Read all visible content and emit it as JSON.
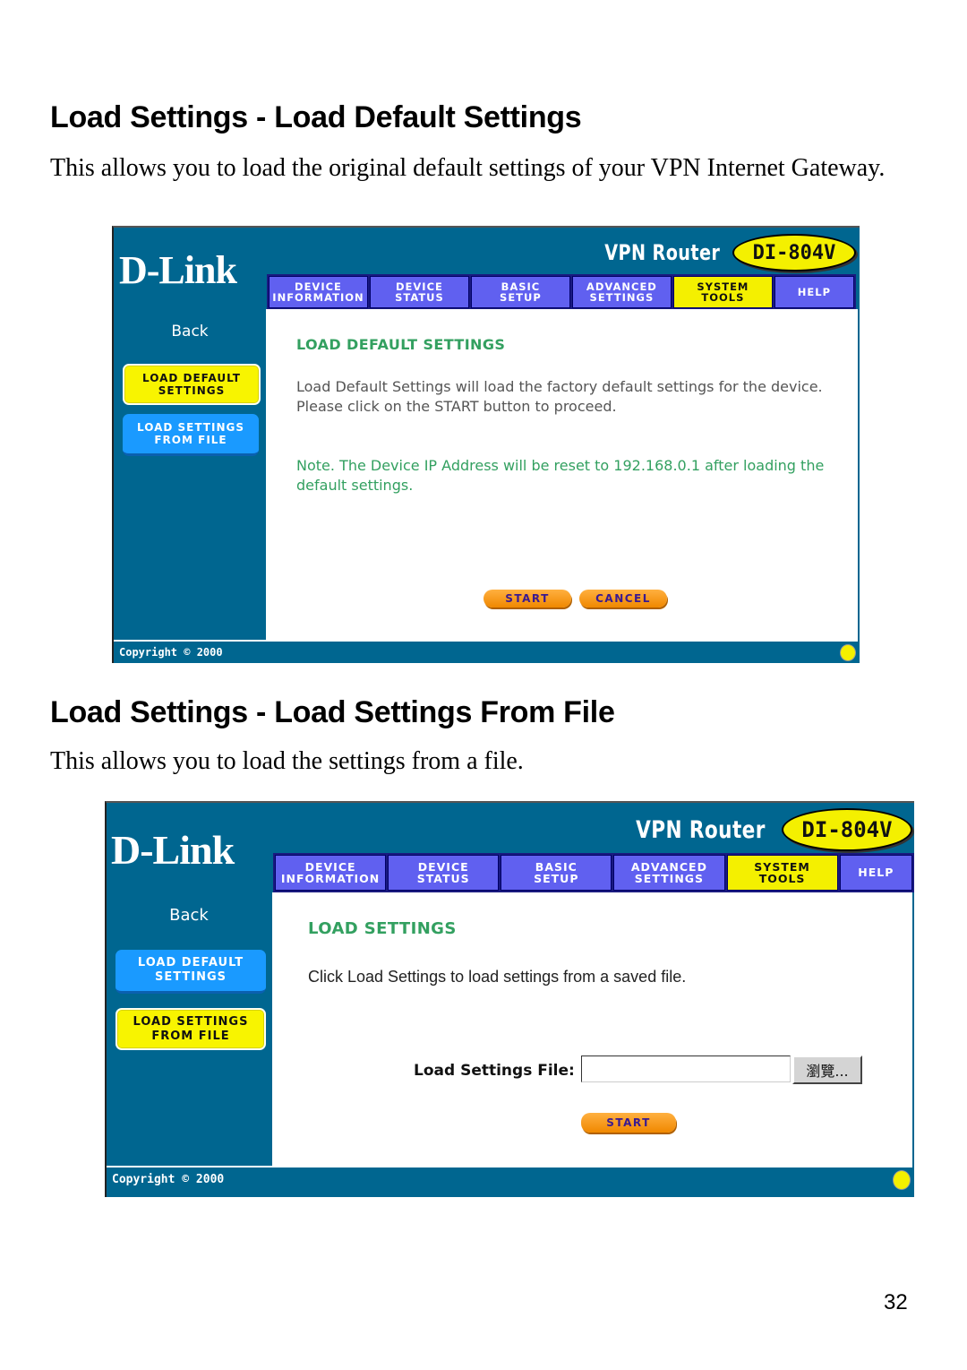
{
  "page": {
    "number": "32"
  },
  "section1": {
    "heading": "Load Settings - Load Default Settings",
    "description": "This allows you to load the original default settings of your VPN Internet Gateway.",
    "screenshot": {
      "logo": "D-Link",
      "product_title": "VPN Router",
      "model": "DI-804V",
      "nav_tabs": [
        {
          "line1": "DEVICE",
          "line2": "INFORMATION",
          "active": false
        },
        {
          "line1": "DEVICE",
          "line2": "STATUS",
          "active": false
        },
        {
          "line1": "BASIC",
          "line2": "SETUP",
          "active": false
        },
        {
          "line1": "ADVANCED",
          "line2": "SETTINGS",
          "active": false
        },
        {
          "line1": "SYSTEM",
          "line2": "TOOLS",
          "active": true
        },
        {
          "line1": "HELP",
          "line2": "",
          "active": false
        }
      ],
      "sidebar": {
        "back_label": "Back",
        "buttons": [
          {
            "line1": "LOAD DEFAULT",
            "line2": "SETTINGS",
            "state": "active"
          },
          {
            "line1": "LOAD SETTINGS",
            "line2": "FROM FILE",
            "state": "inactive"
          }
        ]
      },
      "content": {
        "title": "LOAD DEFAULT SETTINGS",
        "body": "Load Default Settings will load the factory default settings for the device. Please click on the START button to proceed.",
        "note": "Note. The Device IP Address will be reset to 192.168.0.1 after loading the default settings.",
        "start_label": "START",
        "cancel_label": "CANCEL"
      },
      "footer": {
        "copyright": "Copyright © 2000"
      }
    }
  },
  "section2": {
    "heading": "Load Settings - Load Settings From File",
    "description": "This allows you to load the settings from a file.",
    "screenshot": {
      "logo": "D-Link",
      "product_title": "VPN Router",
      "model": "DI-804V",
      "nav_tabs": [
        {
          "line1": "DEVICE",
          "line2": "INFORMATION",
          "active": false
        },
        {
          "line1": "DEVICE",
          "line2": "STATUS",
          "active": false
        },
        {
          "line1": "BASIC",
          "line2": "SETUP",
          "active": false
        },
        {
          "line1": "ADVANCED",
          "line2": "SETTINGS",
          "active": false
        },
        {
          "line1": "SYSTEM",
          "line2": "TOOLS",
          "active": true
        },
        {
          "line1": "HELP",
          "line2": "",
          "active": false
        }
      ],
      "sidebar": {
        "back_label": "Back",
        "buttons": [
          {
            "line1": "LOAD DEFAULT",
            "line2": "SETTINGS",
            "state": "inactive"
          },
          {
            "line1": "LOAD SETTINGS",
            "line2": "FROM FILE",
            "state": "active"
          }
        ]
      },
      "content": {
        "title": "LOAD SETTINGS",
        "body": "Click Load Settings to load settings from a saved file.",
        "file_label": "Load Settings File:",
        "file_value": "",
        "browse_label": "瀏覽...",
        "start_label": "START"
      },
      "footer": {
        "copyright": "Copyright © 2000"
      }
    }
  }
}
